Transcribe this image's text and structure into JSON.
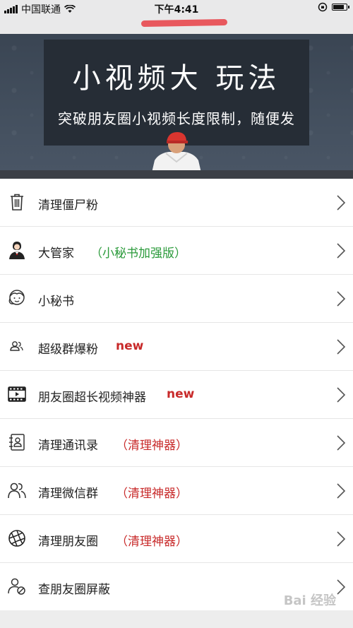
{
  "status_bar": {
    "carrier": "中国联通",
    "time": "下午4:41"
  },
  "banner": {
    "title": "小视频大 玩法",
    "subtitle": "突破朋友圈小视频长度限制，随便发"
  },
  "menu": {
    "items": [
      {
        "label": "清理僵尸粉",
        "tag": "",
        "icon": "trash-icon"
      },
      {
        "label": "大管家",
        "tag": "（小秘书加强版）",
        "icon": "butler-icon"
      },
      {
        "label": "小秘书",
        "tag": "",
        "icon": "secretary-icon"
      },
      {
        "label": "超级群爆粉",
        "tag": "new",
        "icon": "group-users-icon"
      },
      {
        "label": "朋友圈超长视频神器",
        "tag": "new",
        "icon": "film-icon"
      },
      {
        "label": "清理通讯录",
        "tag": "（清理神器）",
        "icon": "contacts-icon"
      },
      {
        "label": "清理微信群",
        "tag": "（清理神器）",
        "icon": "users-icon"
      },
      {
        "label": "清理朋友圈",
        "tag": "（清理神器）",
        "icon": "aperture-icon"
      },
      {
        "label": "查朋友圈屏蔽",
        "tag": "",
        "icon": "user-block-icon"
      }
    ]
  },
  "watermark": "Bai 经验",
  "colors": {
    "tag_green": "#2a9a3a",
    "tag_red": "#c82a2a",
    "banner_bg": "#262d36"
  }
}
